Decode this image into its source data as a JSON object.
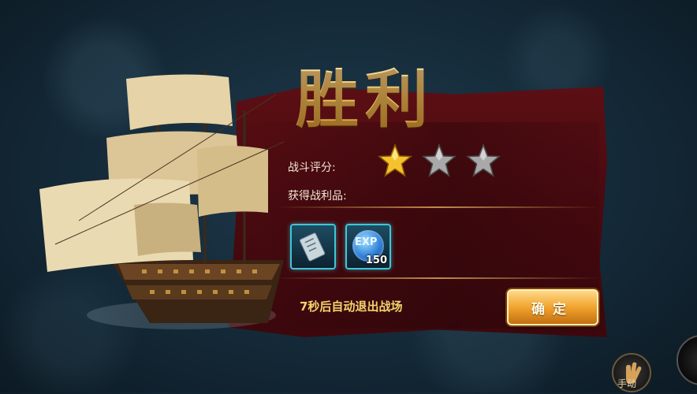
{
  "result": {
    "title": "胜利",
    "rating_label": "战斗评分:",
    "loot_label": "获得战利品:",
    "stars_filled": 1,
    "stars_total": 3
  },
  "rewards": [
    {
      "icon": "wine-ticket-icon",
      "amount": ""
    },
    {
      "icon": "exp-icon",
      "badge_text": "EXP",
      "amount": "150"
    }
  ],
  "footer": {
    "countdown_text": "7秒后自动退出战场",
    "confirm_label": "确定"
  },
  "controls": {
    "manual_label": "手动"
  },
  "colors": {
    "title_gold": "#f1c86d",
    "panel_red": "#4a0a10",
    "item_border": "#3fc7d6",
    "button_orange": "#f1a32e",
    "countdown_yellow": "#f3d36b"
  }
}
